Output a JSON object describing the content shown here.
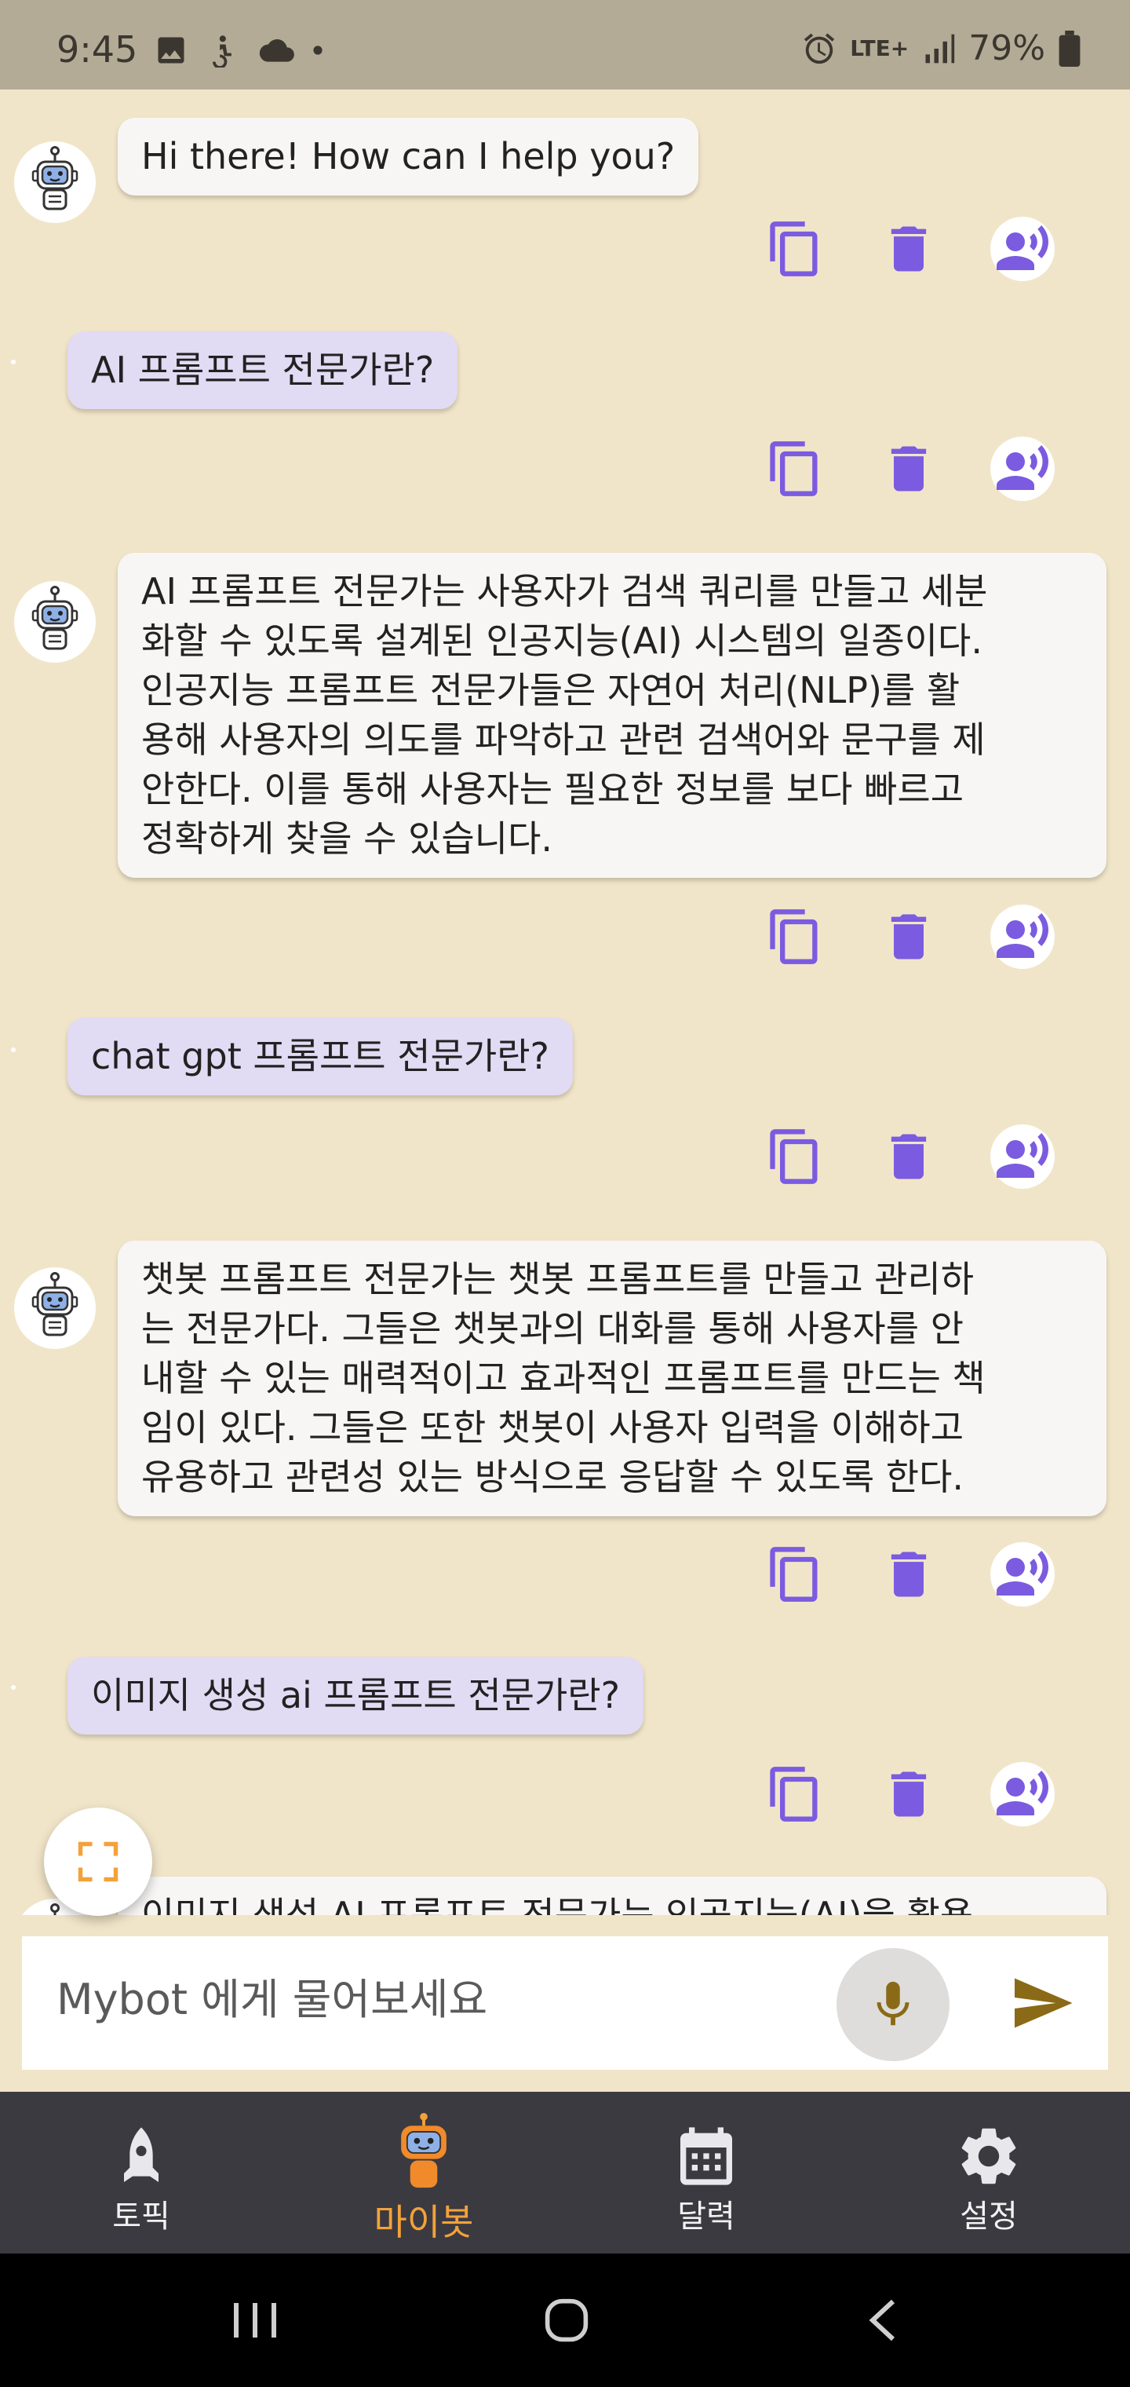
{
  "status_bar": {
    "time": "9:45",
    "network": "LTE+",
    "battery": "79%"
  },
  "chat": {
    "messages": [
      {
        "role": "bot",
        "lines": [
          "Hi there! How can I help you?"
        ]
      },
      {
        "role": "user",
        "lines": [
          "AI 프롬프트 전문가란?"
        ]
      },
      {
        "role": "bot",
        "lines": [
          "AI 프롬프트 전문가는 사용자가 검색 쿼리를 만들고 세분",
          "화할 수 있도록 설계된 인공지능(AI) 시스템의 일종이다.",
          "인공지능 프롬프트 전문가들은 자연어 처리(NLP)를 활",
          "용해 사용자의 의도를 파악하고 관련 검색어와 문구를 제",
          "안한다. 이를 통해 사용자는 필요한 정보를 보다 빠르고",
          "정확하게 찾을 수 있습니다."
        ]
      },
      {
        "role": "user",
        "lines": [
          "chat gpt 프롬프트 전문가란?"
        ]
      },
      {
        "role": "bot",
        "lines": [
          "챗봇 프롬프트 전문가는 챗봇 프롬프트를 만들고 관리하",
          "는 전문가다. 그들은 챗봇과의 대화를 통해 사용자를 안",
          "내할 수 있는 매력적이고 효과적인 프롬프트를 만드는 책",
          "임이 있다. 그들은 또한 챗봇이 사용자 입력을 이해하고",
          "유용하고 관련성 있는 방식으로 응답할 수 있도록 한다."
        ]
      },
      {
        "role": "user",
        "lines": [
          "이미지 생성 ai 프롬프트 전문가란?"
        ]
      },
      {
        "role": "bot",
        "lines": [
          "이미지 생성 AI 프롬프트 전문가는 인공지능(AI)을 활용"
        ]
      }
    ]
  },
  "input": {
    "placeholder": "Mybot 에게 물어보세요"
  },
  "nav": {
    "items": [
      {
        "label": "토픽",
        "icon": "rocket-icon"
      },
      {
        "label": "마이봇",
        "icon": "robot-icon",
        "active": true
      },
      {
        "label": "달력",
        "icon": "calendar-icon"
      },
      {
        "label": "설정",
        "icon": "gear-icon"
      }
    ]
  },
  "colors": {
    "background": "#f1e5c9",
    "accent_purple": "#7b5be0",
    "active_tab": "#f3a23a",
    "nav_bg": "#3b3a41",
    "user_bubble": "#e2dbf4"
  }
}
